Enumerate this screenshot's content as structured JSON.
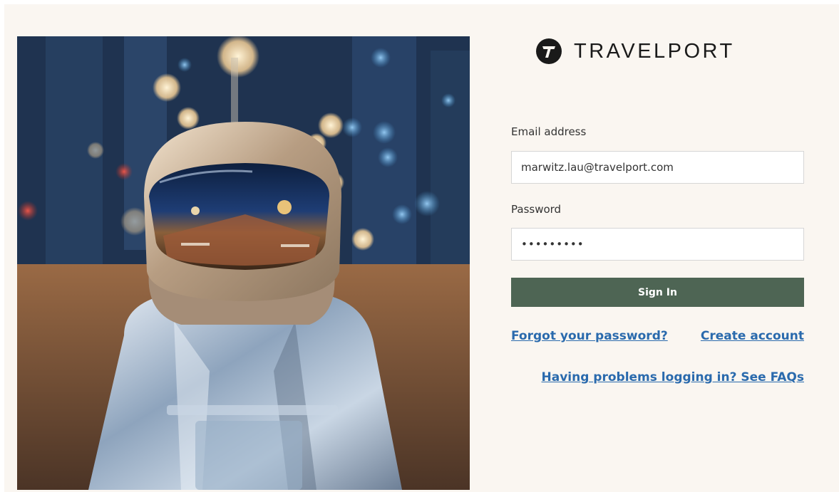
{
  "brand": {
    "name": "TRAVELPORT",
    "logo_icon": "travelport-logo-icon",
    "text_color": "#1a1a1a"
  },
  "hero": {
    "image_subject": "astronaut-in-city-street-photo"
  },
  "form": {
    "email_label": "Email address",
    "email_value": "marwitz.lau@travelport.com",
    "password_label": "Password",
    "password_value": "•••••••••",
    "sign_in_label": "Sign In",
    "button_color": "#4e6554"
  },
  "links": {
    "forgot_password": "Forgot your password?",
    "create_account": "Create account",
    "faq": "Having problems logging in? See FAQs",
    "link_color": "#2a6aad"
  }
}
